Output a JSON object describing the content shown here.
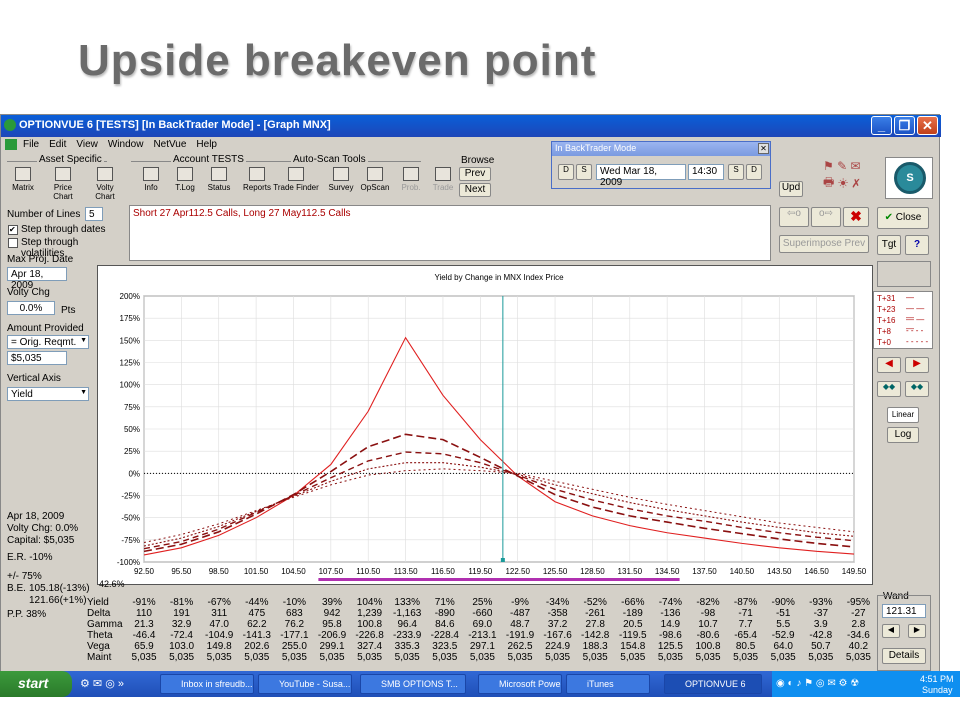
{
  "slide": {
    "title": "Upside breakeven point"
  },
  "window": {
    "title": "OPTIONVUE 6   [TESTS]   [In BackTrader Mode] - [Graph MNX]"
  },
  "menu": [
    "File",
    "Edit",
    "View",
    "Window",
    "NetVue",
    "Help"
  ],
  "groups": {
    "asset": "Asset Specific",
    "account": "Account TESTS",
    "autoscan": "Auto-Scan Tools",
    "browse": "Browse"
  },
  "toolbar": [
    "Matrix",
    "Price Chart",
    "Volty Chart",
    "Info",
    "T.Log",
    "Status",
    "Reports",
    "Trade Finder",
    "Survey",
    "OpScan",
    "Prob.",
    "Trade"
  ],
  "browse": {
    "prev": "Prev",
    "next": "Next"
  },
  "backtrader": {
    "title": "In BackTrader Mode",
    "date": "Wed Mar 18, 2009",
    "time": "14:30",
    "d_label": "D",
    "s_label": "S"
  },
  "upd": "Upd",
  "strategy": "Short 27 Apr112.5 Calls, Long 27 May112.5 Calls",
  "buttons": {
    "close": "Close",
    "superimpose": "Superimpose Prev",
    "tgt": "Tgt",
    "help": "?",
    "linear": "Linear",
    "log": "Log",
    "details": "Details"
  },
  "left": {
    "num_lines_label": "Number of Lines",
    "num_lines": "5",
    "step_dates": "Step through dates",
    "step_vols": "Step through volatilities",
    "max_proj_label": "Max Proj. Date",
    "max_proj": "Apr 18, 2009",
    "volty_chg_label": "Volty Chg",
    "volty_chg": "0.0%",
    "pts": "Pts",
    "amount_label": "Amount Provided",
    "amount_sel": "= Orig. Reqmt.",
    "amount_val": "$5,035",
    "vaxis_label": "Vertical Axis",
    "vaxis": "Yield",
    "info1": "Apr 18, 2009",
    "info2": "Volty Chg:  0.0%",
    "info3": "Capital:  $5,035",
    "er": "E.R.  -10%",
    "pm": "+/-   75%",
    "be_label": "B.E.",
    "be1": "105.18(-13%)",
    "be2": "121.66(+1%)",
    "pp": "P.P.  38%",
    "pct": "42.6%"
  },
  "legend": [
    "T+31",
    "T+23",
    "T+16",
    "T+8",
    "T+0"
  ],
  "wand": {
    "label": "Wand",
    "value": "121.31"
  },
  "chart_data": {
    "type": "line",
    "title": "Yield by Change in MNX Index Price",
    "xlabel": "",
    "ylabel": "",
    "x": [
      92.5,
      95.5,
      98.5,
      101.5,
      104.5,
      107.5,
      110.5,
      113.5,
      116.5,
      119.5,
      122.5,
      125.5,
      128.5,
      131.5,
      134.5,
      137.5,
      140.5,
      143.5,
      146.5,
      149.5
    ],
    "xticks": [
      "92.50",
      "95.50",
      "98.50",
      "101.50",
      "104.50",
      "107.50",
      "110.50",
      "113.50",
      "116.50",
      "119.50",
      "122.50",
      "125.50",
      "128.50",
      "131.50",
      "134.50",
      "137.50",
      "140.50",
      "143.50",
      "146.50",
      "149.50"
    ],
    "yticks": [
      "200%",
      "175%",
      "150%",
      "125%",
      "100%",
      "75%",
      "50%",
      "25%",
      "0%",
      "-25%",
      "-50%",
      "-75%",
      "-100%"
    ],
    "ylim": [
      -100,
      200
    ],
    "xlim": [
      92.5,
      149.5
    ],
    "cursor_x": 121.31,
    "series": [
      {
        "values": [
          -92,
          -84,
          -70,
          -50,
          -25,
          10,
          70,
          153,
          88,
          38,
          -3,
          -32,
          -48,
          -59,
          -67,
          -73,
          -79,
          -84,
          -88,
          -91
        ]
      },
      {
        "values": [
          -88,
          -80,
          -66,
          -46,
          -24,
          2,
          30,
          44,
          38,
          18,
          -3,
          -24,
          -38,
          -48,
          -55,
          -62,
          -68,
          -74,
          -79,
          -83
        ]
      },
      {
        "values": [
          -85,
          -77,
          -63,
          -44,
          -25,
          -5,
          14,
          24,
          22,
          12,
          -2,
          -18,
          -30,
          -40,
          -48,
          -54,
          -61,
          -67,
          -72,
          -76
        ]
      },
      {
        "values": [
          -82,
          -73,
          -60,
          -43,
          -26,
          -9,
          5,
          12,
          12,
          7,
          -1,
          -13,
          -23,
          -33,
          -41,
          -48,
          -55,
          -61,
          -67,
          -71
        ]
      },
      {
        "values": [
          -78,
          -69,
          -57,
          -42,
          -27,
          -13,
          -2,
          3,
          5,
          3,
          0,
          -9,
          -18,
          -27,
          -35,
          -42,
          -49,
          -56,
          -61,
          -66
        ]
      }
    ]
  },
  "table": {
    "headers": [
      "Yield",
      "Delta",
      "Gamma",
      "Theta",
      "Vega",
      "Maint"
    ],
    "rows": [
      [
        "-91%",
        "-81%",
        "-67%",
        "-44%",
        "-10%",
        "39%",
        "104%",
        "133%",
        "71%",
        "25%",
        "-9%",
        "-34%",
        "-52%",
        "-66%",
        "-74%",
        "-82%",
        "-87%",
        "-90%",
        "-93%",
        "-95%"
      ],
      [
        "110",
        "191",
        "311",
        "475",
        "683",
        "942",
        "1,239",
        "-1,163",
        "-890",
        "-660",
        "-487",
        "-358",
        "-261",
        "-189",
        "-136",
        "-98",
        "-71",
        "-51",
        "-37",
        "-27"
      ],
      [
        "21.3",
        "32.9",
        "47.0",
        "62.2",
        "76.2",
        "95.8",
        "100.8",
        "96.4",
        "84.6",
        "69.0",
        "48.7",
        "37.2",
        "27.8",
        "20.5",
        "14.9",
        "10.7",
        "7.7",
        "5.5",
        "3.9",
        "2.8"
      ],
      [
        "-46.4",
        "-72.4",
        "-104.9",
        "-141.3",
        "-177.1",
        "-206.9",
        "-226.8",
        "-233.9",
        "-228.4",
        "-213.1",
        "-191.9",
        "-167.6",
        "-142.8",
        "-119.5",
        "-98.6",
        "-80.6",
        "-65.4",
        "-52.9",
        "-42.8",
        "-34.6"
      ],
      [
        "65.9",
        "103.0",
        "149.8",
        "202.6",
        "255.0",
        "299.1",
        "327.4",
        "335.3",
        "323.5",
        "297.1",
        "262.5",
        "224.9",
        "188.3",
        "154.8",
        "125.5",
        "100.8",
        "80.5",
        "64.0",
        "50.7",
        "40.2"
      ],
      [
        "5,035",
        "5,035",
        "5,035",
        "5,035",
        "5,035",
        "5,035",
        "5,035",
        "5,035",
        "5,035",
        "5,035",
        "5,035",
        "5,035",
        "5,035",
        "5,035",
        "5,035",
        "5,035",
        "5,035",
        "5,035",
        "5,035",
        "5,035"
      ]
    ]
  },
  "taskbar": {
    "start": "start",
    "tasks": [
      "Inbox in sfreudb...",
      "YouTube - Susa...",
      "SMB OPTIONS T...",
      "Microsoft Power...",
      "iTunes",
      "OPTIONVUE 6"
    ],
    "time": "4:51 PM",
    "day": "Sunday"
  }
}
